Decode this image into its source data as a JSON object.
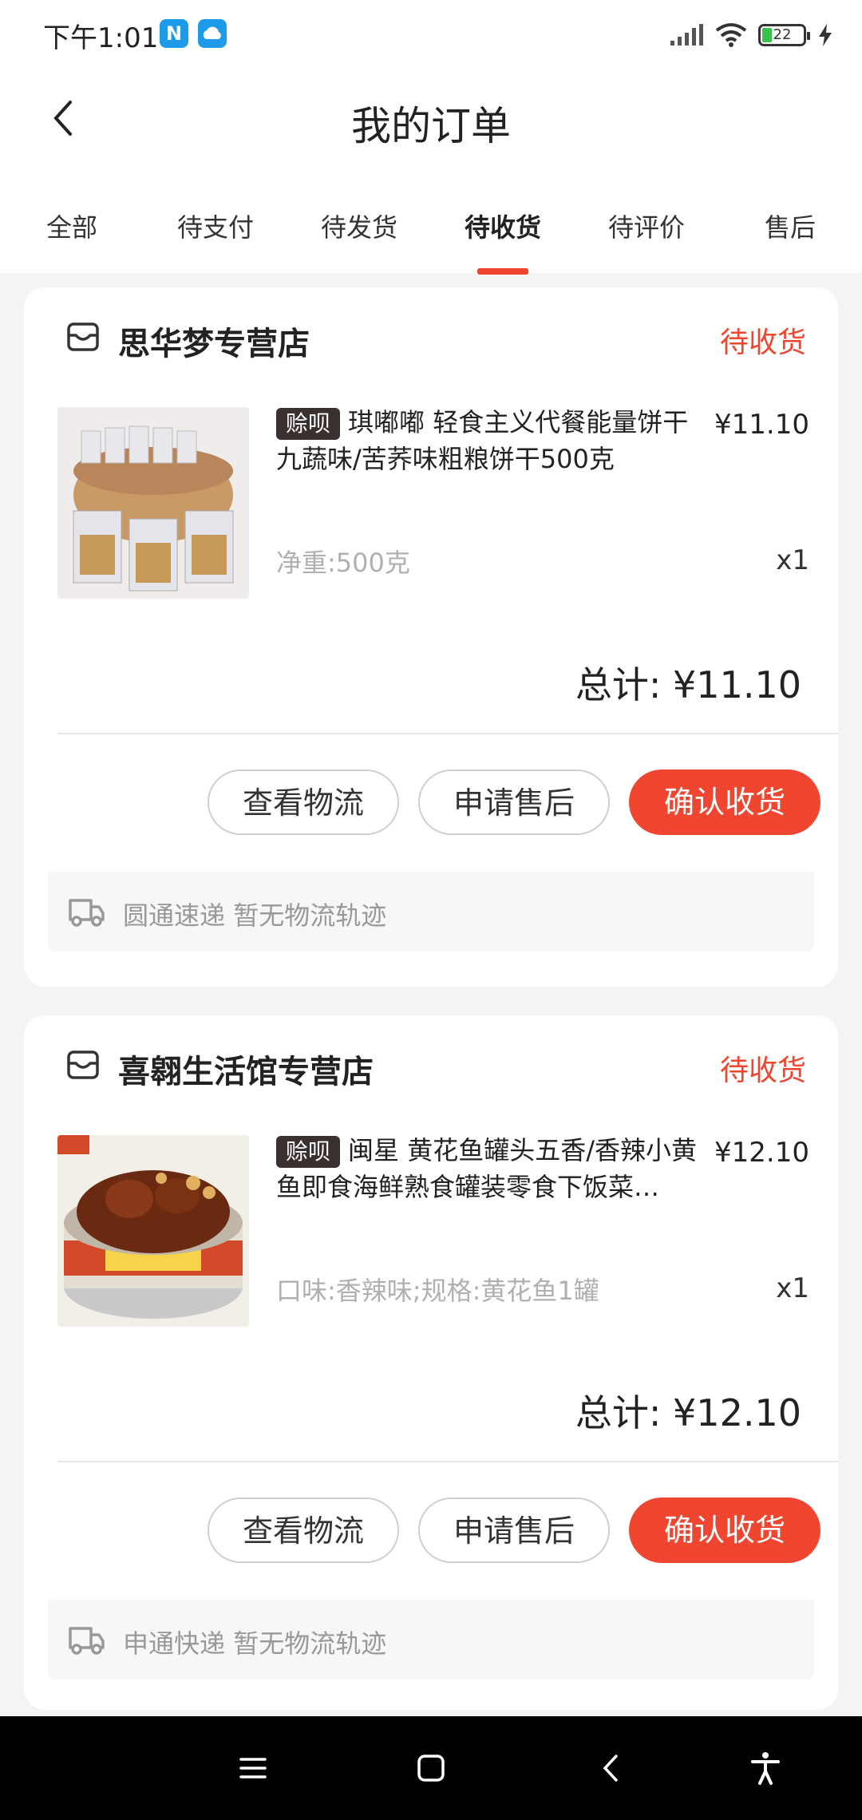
{
  "status_bar": {
    "time": "下午1:01",
    "battery": "22"
  },
  "header": {
    "title": "我的订单"
  },
  "tabs": [
    {
      "label": "全部"
    },
    {
      "label": "待支付"
    },
    {
      "label": "待发货"
    },
    {
      "label": "待收货",
      "active": true
    },
    {
      "label": "待评价"
    },
    {
      "label": "售后"
    }
  ],
  "orders": [
    {
      "store": "思华梦专营店",
      "status": "待收货",
      "tag": "赊呗",
      "product_title": "琪嘟嘟 轻食主义代餐能量饼干九蔬味/苦荞味粗粮饼干500克",
      "price": "¥11.10",
      "spec": "净重:500克",
      "quantity": "x1",
      "total": "总计: ¥11.10",
      "buttons": {
        "logistics": "查看物流",
        "after_sales": "申请售后",
        "confirm": "确认收货"
      },
      "courier": "圆通速递",
      "tracking_status": "暂无物流轨迹"
    },
    {
      "store": "喜翱生活馆专营店",
      "status": "待收货",
      "tag": "赊呗",
      "product_title": "闽星 黄花鱼罐头五香/香辣小黄鱼即食海鲜熟食罐装零食下饭菜…",
      "price": "¥12.10",
      "spec": "口味:香辣味;规格:黄花鱼1罐",
      "quantity": "x1",
      "total": "总计: ¥12.10",
      "buttons": {
        "logistics": "查看物流",
        "after_sales": "申请售后",
        "confirm": "确认收货"
      },
      "courier": "申通快递",
      "tracking_status": "暂无物流轨迹"
    }
  ],
  "colors": {
    "accent": "#f0452e",
    "tag_bg": "#3b3030",
    "muted_text": "#b0b0b0"
  },
  "icons": [
    "back-icon",
    "store-icon",
    "truck-icon",
    "menu-icon",
    "home-icon",
    "nav-back-icon",
    "accessibility-icon"
  ]
}
